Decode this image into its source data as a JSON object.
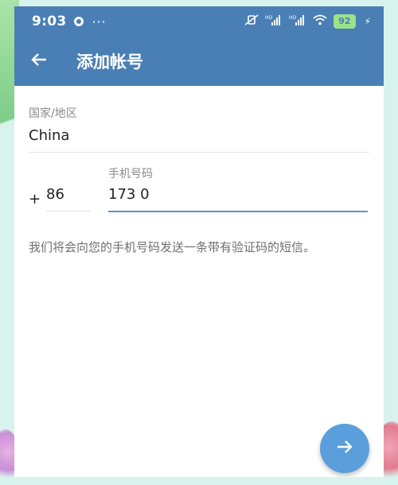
{
  "status_bar": {
    "time": "9:03",
    "more": "···",
    "hd_label": "HD",
    "battery": "92",
    "icons": [
      "vibrate-off-icon",
      "signal-icon",
      "wifi-icon",
      "battery-icon",
      "charging-icon"
    ]
  },
  "app_bar": {
    "title": "添加帐号",
    "back_icon": "arrow-left-icon"
  },
  "form": {
    "country_label": "国家/地区",
    "country_value": "China",
    "plus": "+",
    "country_code": "86",
    "phone_label": "手机号码",
    "phone_value": "173 0"
  },
  "hint": "我们将会向您的手机号码发送一条带有验证码的短信。",
  "fab": {
    "icon": "arrow-right-icon"
  },
  "colors": {
    "primary": "#4a7fb5",
    "accent": "#5a9fdb",
    "input_underline_active": "#5a95c9",
    "background": "#ffffff"
  }
}
